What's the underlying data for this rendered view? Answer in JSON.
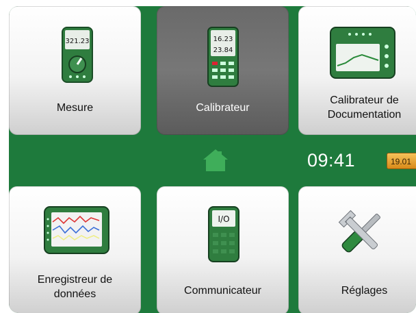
{
  "tiles": {
    "mesure": {
      "label": "Mesure",
      "icon": "multimeter-icon",
      "display_value": "321.23"
    },
    "calibrateur": {
      "label": "Calibrateur",
      "icon": "calibrator-device-icon",
      "display_top": "16.23",
      "display_bottom": "23.84"
    },
    "documentation": {
      "label_line1": "Calibrateur de",
      "label_line2": "Documentation",
      "icon": "documenting-calibrator-icon"
    },
    "enregistreur": {
      "label_line1": "Enregistreur de",
      "label_line2": "données",
      "icon": "data-logger-icon"
    },
    "communicateur": {
      "label": "Communicateur",
      "icon": "communicator-io-icon",
      "icon_text": "I/O"
    },
    "reglages": {
      "label": "Réglages",
      "icon": "wrench-screwdriver-icon"
    }
  },
  "status": {
    "home_icon": "home-icon",
    "time": "09:41",
    "badge": "19.01"
  },
  "colors": {
    "frame_green": "#1e7a3c",
    "active_tile": "#6f6f6f",
    "badge_orange": "#e9a43a"
  }
}
